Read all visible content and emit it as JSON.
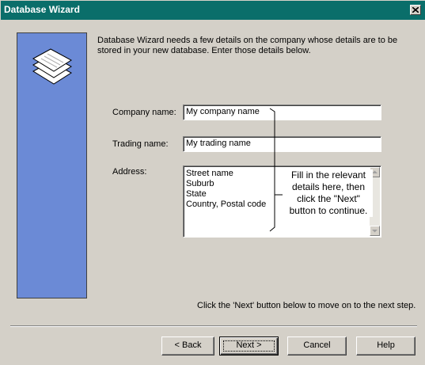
{
  "window": {
    "title": "Database Wizard",
    "close_icon": "close-icon"
  },
  "intro": "Database Wizard needs a few details on the company whose details are to be stored in your new database. Enter those details below.",
  "form": {
    "company_label": "Company name:",
    "company_value": "My company name",
    "trading_label": "Trading name:",
    "trading_value": "My trading name",
    "address_label": "Address:",
    "address_lines": [
      "Street name",
      "Suburb",
      "State",
      "Country, Postal code"
    ]
  },
  "callout": [
    "Fill in the relevant",
    "details here, then",
    "click the \"Next\"",
    "button to continue."
  ],
  "hint": "Click the 'Next' button below to move on to the next step.",
  "buttons": {
    "back": "< Back",
    "next": "Next >",
    "cancel": "Cancel",
    "help": "Help"
  },
  "colors": {
    "titlebar": "#0a6e6a",
    "sidepanel": "#6b8ad6",
    "face": "#d4d0c8"
  },
  "icons": {
    "side_panel_icon": "stacked-pages-icon"
  }
}
